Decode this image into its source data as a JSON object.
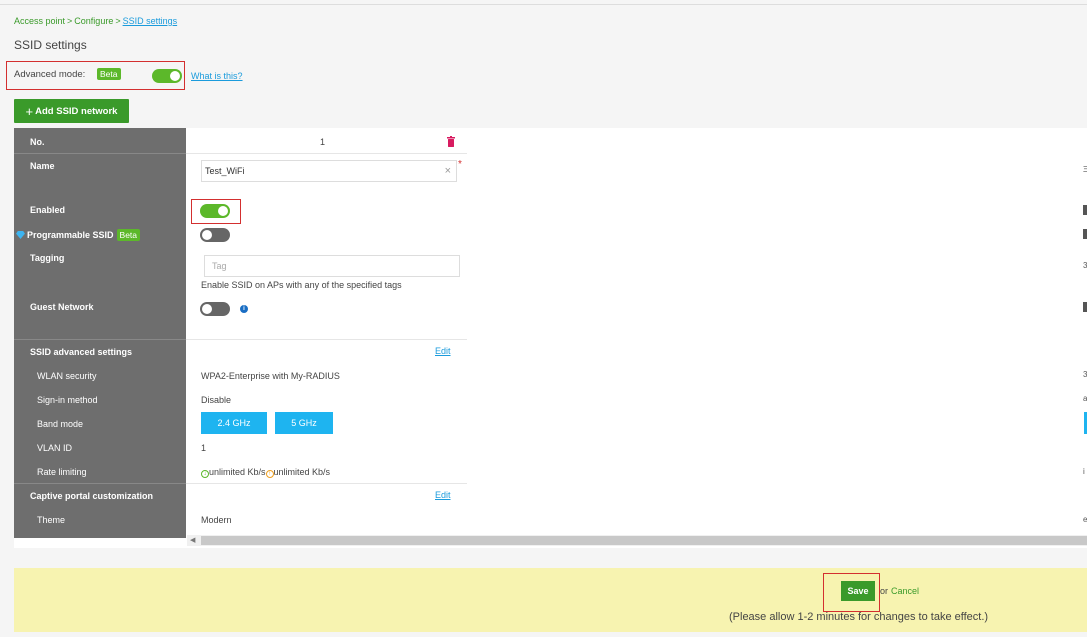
{
  "breadcrumb": {
    "items": [
      "Access point",
      "Configure"
    ],
    "separator": ">",
    "current": "SSID settings"
  },
  "page_title": "SSID settings",
  "advanced_mode": {
    "label": "Advanced mode:",
    "badge": "Beta",
    "enabled": true,
    "help_link": "What is this?"
  },
  "add_button": {
    "plus": "+",
    "label": "Add SSID network"
  },
  "table": {
    "labels": {
      "no": "No.",
      "name": "Name",
      "enabled": "Enabled",
      "programmable_ssid": "Programmable SSID",
      "programmable_badge": "Beta",
      "tagging": "Tagging",
      "guest_network": "Guest Network",
      "ssid_advanced_settings": "SSID advanced settings",
      "wlan_security": "WLAN security",
      "sign_in_method": "Sign-in method",
      "band_mode": "Band mode",
      "vlan_id": "VLAN ID",
      "rate_limiting": "Rate limiting",
      "captive_portal_customization": "Captive portal customization",
      "theme": "Theme"
    },
    "ssid": {
      "number": "1",
      "name": "Test_WiFi",
      "enabled": true,
      "programmable_ssid": false,
      "tag_placeholder": "Tag",
      "tag_hint": "Enable SSID on APs with any of the specified tags",
      "guest_network": false,
      "edit_advanced": "Edit",
      "wlan_security": "WPA2-Enterprise with My-RADIUS",
      "sign_in_method": "Disable",
      "band_24": "2.4 GHz",
      "band_5": "5 GHz",
      "vlan_id": "1",
      "rate_down": "unlimited Kb/s",
      "rate_up": "unlimited Kb/s",
      "edit_captive": "Edit",
      "theme": "Modern"
    },
    "next_column_edge": [
      "Ξ",
      "3",
      "a",
      "i",
      "e"
    ]
  },
  "footer": {
    "save": "Save",
    "or": "or",
    "cancel": "Cancel",
    "note": "(Please allow 1-2 minutes for changes to take effect.)"
  },
  "colors": {
    "accent_green": "#5cb82a",
    "button_green": "#3a9a2a",
    "link_blue": "#1a9bdc",
    "band_blue": "#1eb4f0",
    "highlight_red": "#d32f2f",
    "footer_yellow": "#f7f3b0"
  }
}
